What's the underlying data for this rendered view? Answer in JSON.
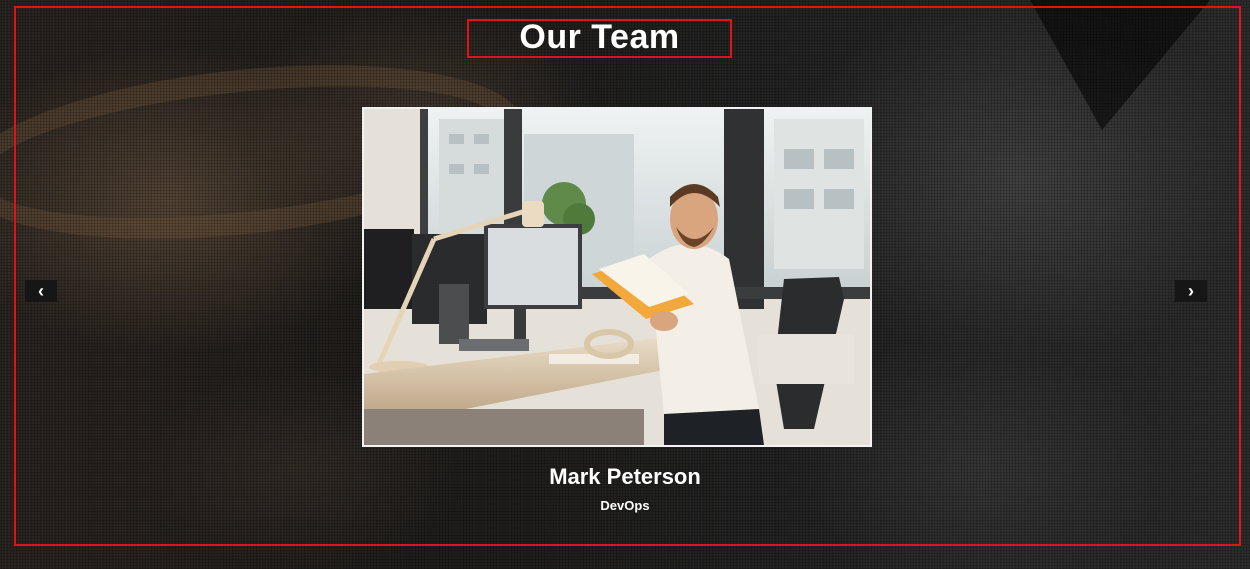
{
  "section": {
    "title": "Our Team"
  },
  "carousel": {
    "prev_glyph": "‹",
    "next_glyph": "›",
    "prev_icon": "chevron-left-icon",
    "next_icon": "chevron-right-icon"
  },
  "member": {
    "name": "Mark Peterson",
    "role": "DevOps",
    "photo_subject": "man smiling at desk holding an open orange book"
  },
  "colors": {
    "frame_outline": "#e0121a",
    "text": "#ffffff",
    "arrow_bg": "#161616"
  }
}
